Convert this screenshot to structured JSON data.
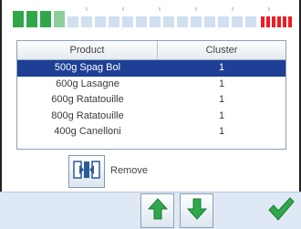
{
  "meter": {
    "level": 0.23,
    "colors": {
      "good": "#2ea84a",
      "empty": "#cfe0f0",
      "warn": "#ee1c24"
    }
  },
  "table": {
    "columns": {
      "product": "Product",
      "cluster": "Cluster"
    },
    "rows": [
      {
        "product": "500g Spag Bol",
        "cluster": "1",
        "selected": true
      },
      {
        "product": "600g Lasagne",
        "cluster": "1",
        "selected": false
      },
      {
        "product": "600g Ratatouille",
        "cluster": "1",
        "selected": false
      },
      {
        "product": "800g Ratatouille",
        "cluster": "1",
        "selected": false
      },
      {
        "product": "400g Canelloni",
        "cluster": "1",
        "selected": false
      }
    ],
    "selected_color": "#1e3f94"
  },
  "actions": {
    "remove_label": "Remove",
    "remove_icon": "remove-column-icon",
    "move_up_icon": "arrow-up-icon",
    "move_down_icon": "arrow-down-icon",
    "confirm_icon": "checkmark-icon",
    "accent": "#2ea84a"
  }
}
